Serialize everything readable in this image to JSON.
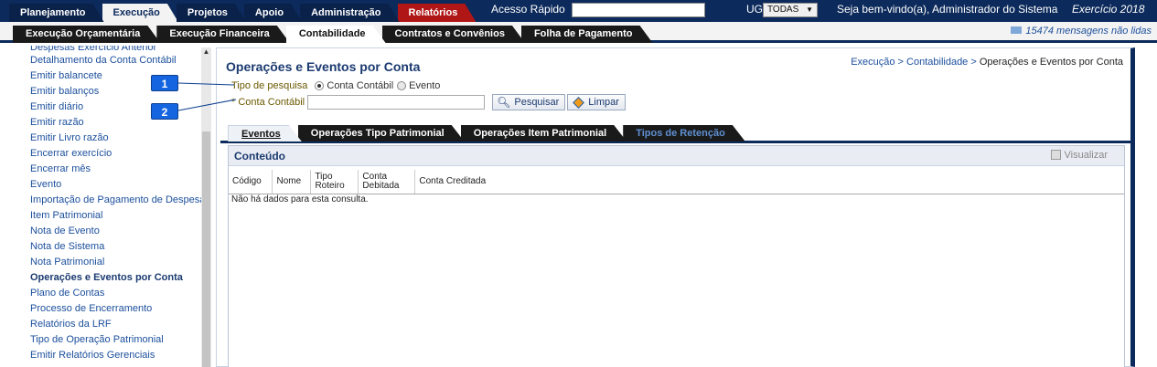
{
  "top_nav": {
    "tabs": [
      "Planejamento",
      "Execução",
      "Projetos",
      "Apoio",
      "Administração",
      "Relatórios"
    ],
    "active": "Execução",
    "acesso_rapido_label": "Acesso Rápido",
    "acesso_rapido_value": "",
    "ug_label": "UG",
    "ug_value": "TODAS",
    "welcome": "Seja bem-vindo(a), Administrador do Sistema",
    "exercicio": "Exercício 2018"
  },
  "sub_nav": {
    "tabs": [
      "Execução Orçamentária",
      "Execução Financeira",
      "Contabilidade",
      "Contratos e Convênios",
      "Folha de Pagamento"
    ],
    "active": "Contabilidade",
    "messages": "15474 mensagens não lidas"
  },
  "sidebar": {
    "cut_item": "Despesas Exercício Anterior",
    "items": [
      "Detalhamento da Conta Contábil",
      "Emitir balancete",
      "Emitir balanços",
      "Emitir diário",
      "Emitir razão",
      "Emitir Livro razão",
      "Encerrar exercício",
      "Encerrar mês",
      "Evento",
      "Importação de Pagamento de Despesas",
      "Item Patrimonial",
      "Nota de Evento",
      "Nota de Sistema",
      "Nota Patrimonial",
      "Operações e Eventos por Conta",
      "Plano de Contas",
      "Processo de Encerramento",
      "Relatórios da LRF",
      "Tipo de Operação Patrimonial",
      "Emitir Relatórios Gerenciais"
    ],
    "active": "Operações e Eventos por Conta"
  },
  "main": {
    "title": "Operações e Eventos por Conta",
    "breadcrumb_prefix": "Execução > Contabilidade > ",
    "breadcrumb_current": "Operações e Eventos por Conta",
    "tipo_pesquisa_label": "Tipo de pesquisa",
    "radio_conta": "Conta Contábil",
    "radio_evento": "Evento",
    "radio_selected": "Conta Contábil",
    "conta_required_marker": "*",
    "conta_label": "Conta Contábil",
    "conta_value": "",
    "pesquisar_label": "Pesquisar",
    "limpar_label": "Limpar",
    "content_tabs": [
      "Eventos",
      "Operações Tipo Patrimonial",
      "Operações Item Patrimonial",
      "Tipos de Retenção"
    ],
    "content_active_tab": "Eventos",
    "content_title": "Conteúdo",
    "visualizar_label": "Visualizar",
    "table": {
      "columns": [
        "Código",
        "Nome",
        "Tipo Roteiro",
        "Conta Debitada",
        "Conta Creditada"
      ],
      "empty_message": "Não há dados para esta consulta."
    }
  },
  "callouts": [
    "1",
    "2"
  ],
  "colors": {
    "header_bg": "#0c2a5b",
    "reports_tab": "#b01616",
    "link": "#1b4f9c",
    "callout": "#1565e0"
  }
}
